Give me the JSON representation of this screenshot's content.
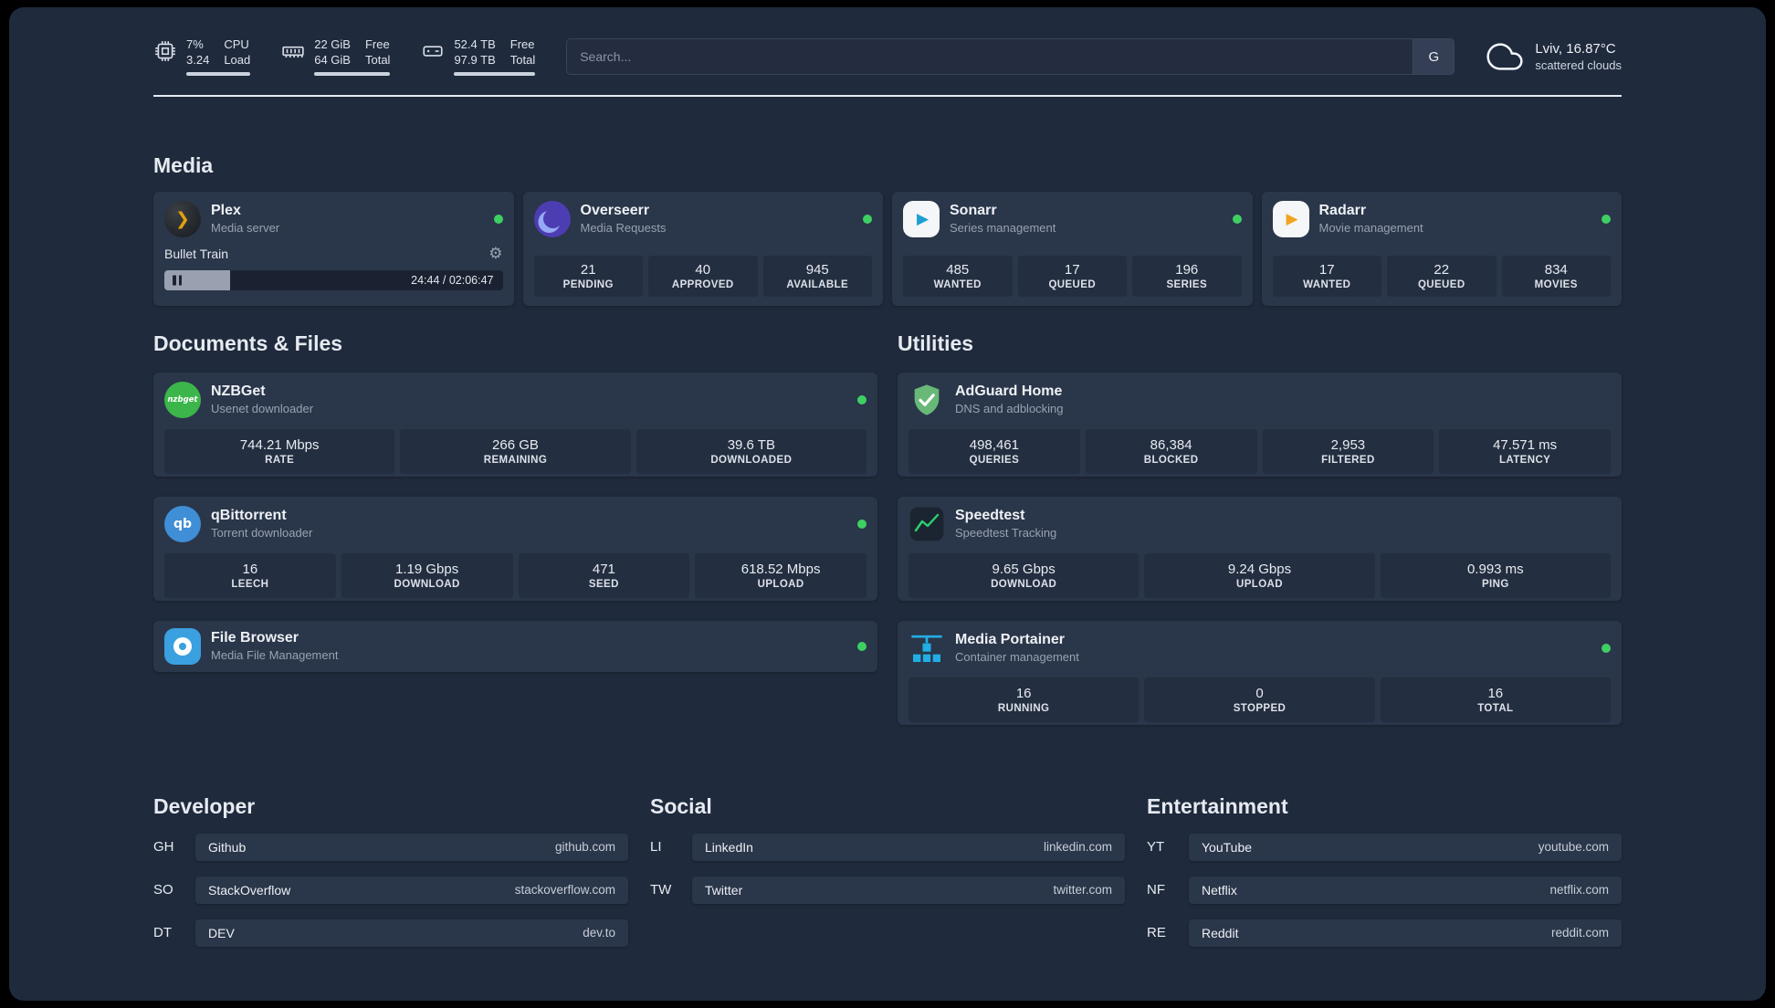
{
  "header": {
    "cpu": {
      "percent": "7%",
      "load": "3.24",
      "label_top": "CPU",
      "label_bottom": "Load"
    },
    "memory": {
      "free": "22 GiB",
      "total": "64 GiB",
      "label_top": "Free",
      "label_bottom": "Total"
    },
    "storage": {
      "free": "52.4 TB",
      "total": "97.9 TB",
      "label_top": "Free",
      "label_bottom": "Total"
    },
    "search": {
      "placeholder": "Search...",
      "engine": "G"
    },
    "weather": {
      "location": "Lviv, 16.87°C",
      "condition": "scattered clouds"
    }
  },
  "sections": {
    "media": "Media",
    "documents": "Documents & Files",
    "utilities": "Utilities",
    "developer": "Developer",
    "social": "Social",
    "entertainment": "Entertainment"
  },
  "icons": {
    "plex_glyph": "❯",
    "play_glyph": "▶",
    "gear_glyph": "⚙"
  },
  "apps": {
    "plex": {
      "name": "Plex",
      "desc": "Media server",
      "now_playing": "Bullet Train",
      "time": "24:44 / 02:06:47",
      "progress_percent": 19.5
    },
    "overseerr": {
      "name": "Overseerr",
      "desc": "Media Requests",
      "stats": [
        {
          "value": "21",
          "label": "PENDING"
        },
        {
          "value": "40",
          "label": "APPROVED"
        },
        {
          "value": "945",
          "label": "AVAILABLE"
        }
      ]
    },
    "sonarr": {
      "name": "Sonarr",
      "desc": "Series management",
      "stats": [
        {
          "value": "485",
          "label": "WANTED"
        },
        {
          "value": "17",
          "label": "QUEUED"
        },
        {
          "value": "196",
          "label": "SERIES"
        }
      ]
    },
    "radarr": {
      "name": "Radarr",
      "desc": "Movie management",
      "stats": [
        {
          "value": "17",
          "label": "WANTED"
        },
        {
          "value": "22",
          "label": "QUEUED"
        },
        {
          "value": "834",
          "label": "MOVIES"
        }
      ]
    },
    "nzbget": {
      "name": "NZBGet",
      "desc": "Usenet downloader",
      "icon_text": "nzbget",
      "stats": [
        {
          "value": "744.21 Mbps",
          "label": "RATE"
        },
        {
          "value": "266 GB",
          "label": "REMAINING"
        },
        {
          "value": "39.6 TB",
          "label": "DOWNLOADED"
        }
      ]
    },
    "qbittorrent": {
      "name": "qBittorrent",
      "desc": "Torrent downloader",
      "icon_text": "qb",
      "stats": [
        {
          "value": "16",
          "label": "LEECH"
        },
        {
          "value": "1.19 Gbps",
          "label": "DOWNLOAD"
        },
        {
          "value": "471",
          "label": "SEED"
        },
        {
          "value": "618.52 Mbps",
          "label": "UPLOAD"
        }
      ]
    },
    "filebrowser": {
      "name": "File Browser",
      "desc": "Media File Management"
    },
    "adguard": {
      "name": "AdGuard Home",
      "desc": "DNS and adblocking",
      "stats": [
        {
          "value": "498,461",
          "label": "QUERIES"
        },
        {
          "value": "86,384",
          "label": "BLOCKED"
        },
        {
          "value": "2,953",
          "label": "FILTERED"
        },
        {
          "value": "47.571 ms",
          "label": "LATENCY"
        }
      ]
    },
    "speedtest": {
      "name": "Speedtest",
      "desc": "Speedtest Tracking",
      "stats": [
        {
          "value": "9.65 Gbps",
          "label": "DOWNLOAD"
        },
        {
          "value": "9.24 Gbps",
          "label": "UPLOAD"
        },
        {
          "value": "0.993 ms",
          "label": "PING"
        }
      ]
    },
    "portainer": {
      "name": "Media Portainer",
      "desc": "Container management",
      "stats": [
        {
          "value": "16",
          "label": "RUNNING"
        },
        {
          "value": "0",
          "label": "STOPPED"
        },
        {
          "value": "16",
          "label": "TOTAL"
        }
      ]
    }
  },
  "bookmarks": {
    "developer": [
      {
        "abbr": "GH",
        "name": "Github",
        "url": "github.com"
      },
      {
        "abbr": "SO",
        "name": "StackOverflow",
        "url": "stackoverflow.com"
      },
      {
        "abbr": "DT",
        "name": "DEV",
        "url": "dev.to"
      }
    ],
    "social": [
      {
        "abbr": "LI",
        "name": "LinkedIn",
        "url": "linkedin.com"
      },
      {
        "abbr": "TW",
        "name": "Twitter",
        "url": "twitter.com"
      }
    ],
    "entertainment": [
      {
        "abbr": "YT",
        "name": "YouTube",
        "url": "youtube.com"
      },
      {
        "abbr": "NF",
        "name": "Netflix",
        "url": "netflix.com"
      },
      {
        "abbr": "RE",
        "name": "Reddit",
        "url": "reddit.com"
      }
    ]
  },
  "colors": {
    "status_online": "#3ecf63",
    "plex_amber": "#e5a00d",
    "sonarr_blue": "#1e9fd4",
    "radarr_amber": "#f0a51f",
    "adguard_green": "#68b978",
    "portainer_blue": "#22aee5",
    "speedtest_green": "#2ecf6f"
  }
}
